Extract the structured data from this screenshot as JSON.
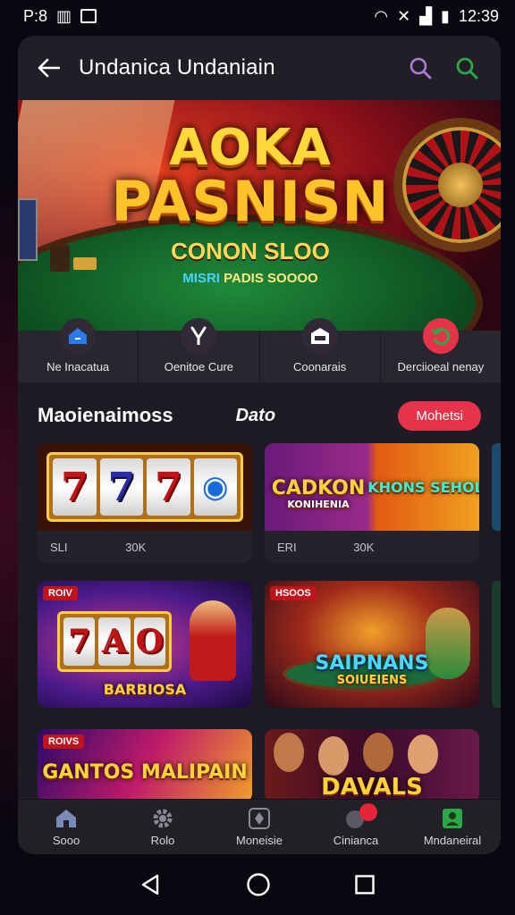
{
  "status_bar": {
    "left_text": "P:8",
    "time": "12:39"
  },
  "header": {
    "title": "Undanica Undaniain",
    "back_icon": "back-arrow-icon",
    "search_icon": "search-icon",
    "search_alt_icon": "search-icon"
  },
  "hero": {
    "line1": "AOKA",
    "line2": "PASNISN",
    "subtitle": "CONON SLOO",
    "tagline_1": "MISRI",
    "tagline_2": "PADIS SOOOO"
  },
  "quick_actions": [
    {
      "label": "Ne Inacatua",
      "icon": "home-icon",
      "color": "#2a7be8"
    },
    {
      "label": "Oenitoe Cure",
      "icon": "microphone-icon",
      "color": "#ffffff"
    },
    {
      "label": "Coonarais",
      "icon": "store-icon",
      "color": "#ffffff"
    },
    {
      "label": "Derciioeal nenay",
      "icon": "refresh-icon",
      "color": "#e5344a"
    }
  ],
  "section": {
    "title": "Maoienaimoss",
    "subtitle": "Dato",
    "button_label": "Mohetsi"
  },
  "cards": [
    {
      "meta_left": "SLI",
      "meta_right": "30K",
      "reels": [
        "7",
        "7",
        "7",
        "◉"
      ]
    },
    {
      "title_1": "CADKON",
      "title_2": "KONIHENIA",
      "title_3": "KHONS SEHOL",
      "meta_left": "ERI",
      "meta_right": "30K"
    },
    {
      "badge": "ROIV",
      "reels": [
        "7",
        "A",
        "O"
      ],
      "title": "BARBIOSA"
    },
    {
      "badge": "HSOOS",
      "title_1": "SAIPNANS",
      "title_2": "SOIUEIENS"
    },
    {
      "badge": "ROIVS",
      "title": "GANTOS MALIPAIN"
    },
    {
      "title": "DAVALS"
    }
  ],
  "bottom_nav": [
    {
      "label": "Sooo",
      "icon": "home-icon"
    },
    {
      "label": "Rolo",
      "icon": "gear-icon"
    },
    {
      "label": "Moneisie",
      "icon": "shield-icon"
    },
    {
      "label": "Cinianca",
      "icon": "wallet-icon"
    },
    {
      "label": "Mndaneiral",
      "icon": "profile-icon"
    }
  ],
  "colors": {
    "accent_red": "#e5344a",
    "accent_green": "#2ba84a",
    "accent_purple": "#b07ad8"
  }
}
